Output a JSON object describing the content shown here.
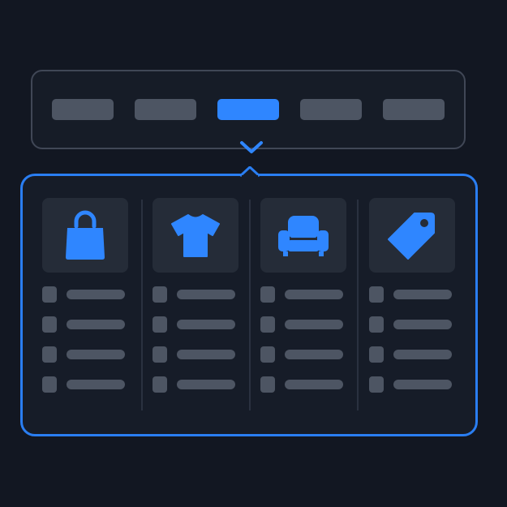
{
  "colors": {
    "background": "#121722",
    "panel": "#161c28",
    "accent": "#2f86ff",
    "placeholder": "#4d5563",
    "tile": "#252c38",
    "nav_border": "#404756"
  },
  "nav": {
    "tabs": [
      {
        "label": "",
        "active": false
      },
      {
        "label": "",
        "active": false
      },
      {
        "label": "",
        "active": true
      },
      {
        "label": "",
        "active": false
      },
      {
        "label": "",
        "active": false
      }
    ]
  },
  "mega_menu": {
    "columns": [
      {
        "icon": "shopping-bag-icon",
        "item_count": 4
      },
      {
        "icon": "t-shirt-icon",
        "item_count": 4
      },
      {
        "icon": "armchair-icon",
        "item_count": 4
      },
      {
        "icon": "price-tag-icon",
        "item_count": 4
      }
    ]
  }
}
